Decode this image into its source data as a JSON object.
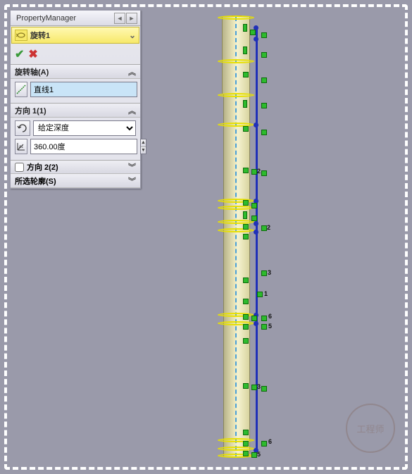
{
  "pm": {
    "title": "PropertyManager"
  },
  "feature": {
    "name": "旋转1"
  },
  "axis": {
    "header": "旋转轴(A)",
    "value": "直线1"
  },
  "dir1": {
    "header": "方向 1(1)",
    "endcond": "给定深度",
    "angle": "360.00度"
  },
  "dir2": {
    "label": "方向 2(2)"
  },
  "contours": {
    "header": "所选轮廓(S)"
  },
  "watermark": "工程师",
  "marks": {
    "labels": [
      "2",
      "2",
      "3",
      "1",
      "6",
      "5",
      "3",
      "6",
      "5"
    ]
  }
}
